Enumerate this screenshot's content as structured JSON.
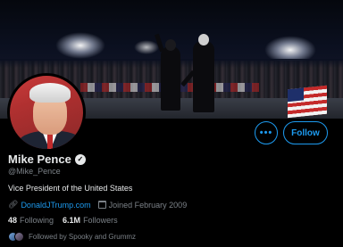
{
  "profile": {
    "name": "Mike Pence",
    "handle": "@Mike_Pence",
    "bio": "Vice President of the United States",
    "website": "DonaldJTrump.com",
    "joined": "Joined February 2009",
    "following_count": "48",
    "following_label": "Following",
    "followers_count": "6.1M",
    "followers_label": "Followers",
    "followed_by": "Followed by Spooky and Grummz"
  },
  "actions": {
    "more_label": "•••",
    "follow_label": "Follow"
  },
  "icons": {
    "verified": "verified-check-icon",
    "link": "link-icon",
    "calendar": "calendar-icon",
    "more": "more-options-icon"
  },
  "colors": {
    "accent": "#1d9bf0",
    "background": "#000000",
    "text_primary": "#e7e9ea",
    "text_secondary": "#7c8288"
  }
}
